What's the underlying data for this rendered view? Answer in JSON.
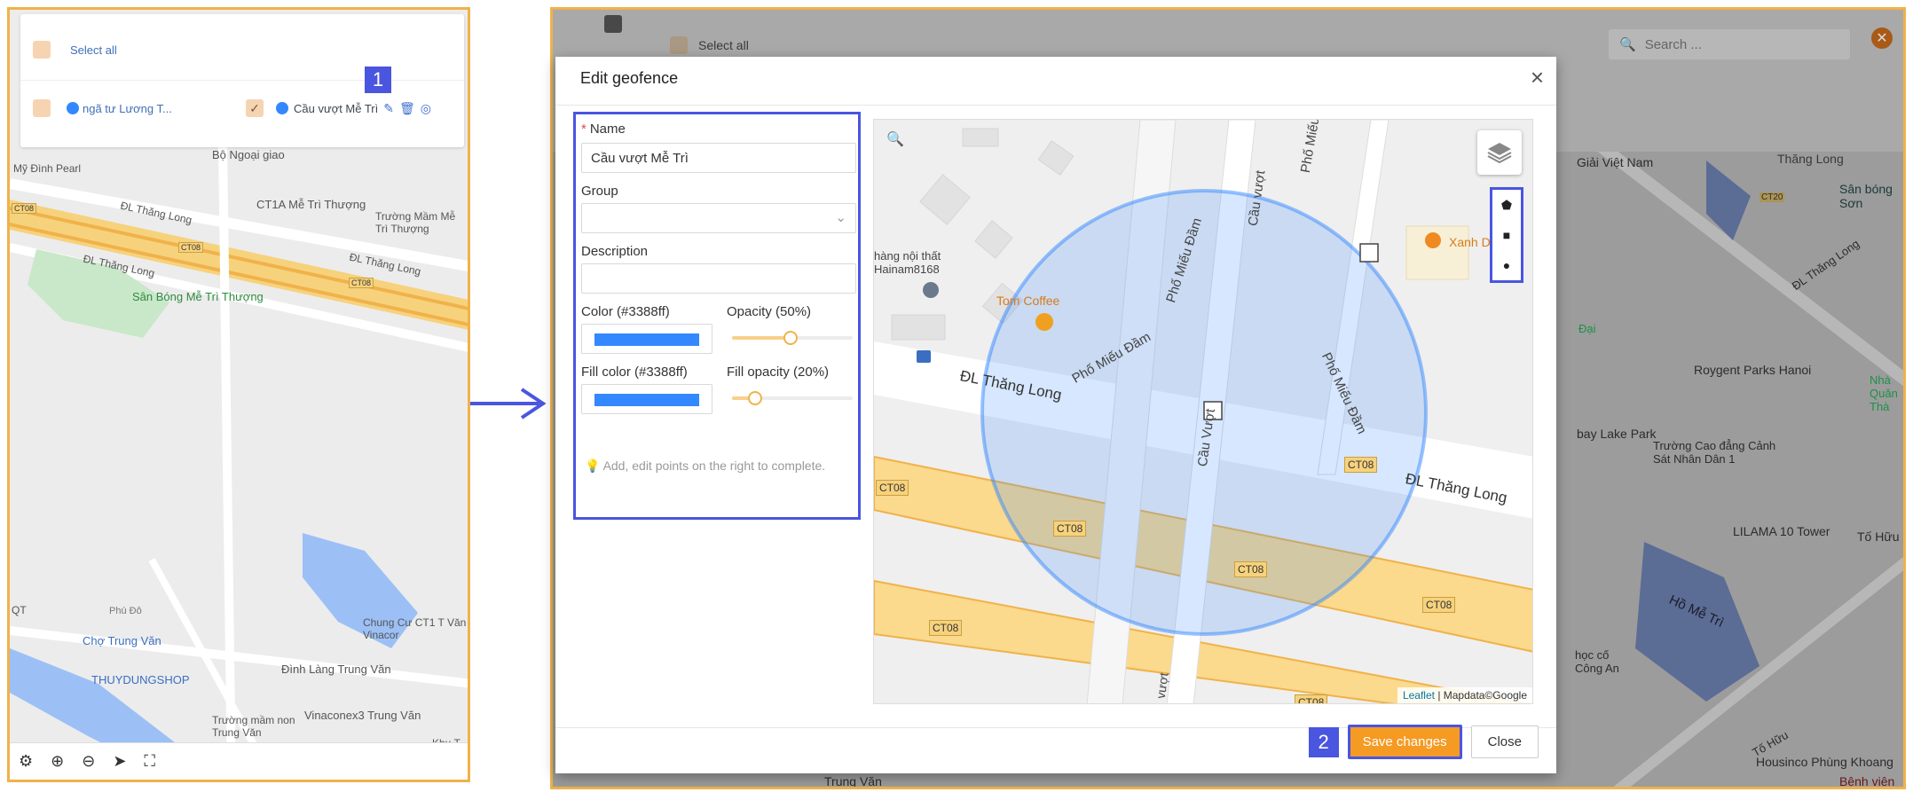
{
  "left_panel": {
    "select_all": "Select all",
    "items": [
      {
        "label": "ngã tư Lương T..."
      },
      {
        "label": "Cầu vượt Mễ Trì"
      }
    ],
    "badge": "1",
    "map_labels": {
      "my_dinh_pearl": "Mỹ Đình Pearl",
      "bo_ngoai_giao": "Bộ Ngoại giao",
      "dl_thang_long_1": "ĐL Thăng Long",
      "dl_thang_long_2": "ĐL Thăng Long",
      "dl_thang_long_3": "ĐL Thăng Long",
      "ct1a": "CT1A Mễ Trì Thượng",
      "truong_mam": "Trường Mầm Mễ Trì Thượng",
      "san_bong": "Sân Bóng Mễ Trì Thượng",
      "phu_do": "Phú Đô",
      "cho_trung_van": "Chợ Trung Văn",
      "thuydungshop": "THUYDUNGSHOP",
      "dinh_lang": "Đình Làng Trung Văn",
      "truong_mam_non": "Trường mầm non Trung Văn",
      "vinaconex3": "Vinaconex3 Trung Văn",
      "chung_cu": "Chung Cư CT1 T Văn Vinacor",
      "khu": "Khu T",
      "qt": "QT",
      "ct08_a": "CT08",
      "ct08_b": "CT08",
      "ct08_c": "CT08"
    }
  },
  "right_panel": {
    "select_all": "Select all",
    "search_placeholder": "Search ...",
    "close_icon": "✕",
    "bg_labels": {
      "giai_viet_nam": "Giải Việt Nam",
      "thang_long": "Thăng Long",
      "san_bong_son": "Sân bóng Sơn",
      "dl_thang_long": "ĐL Thăng Long",
      "royal_parks": "Roygent Parks Hanoi",
      "bay_lake_park": "bay Lake Park",
      "truong_cao_dang": "Trường Cao đẳng Cảnh Sát Nhân Dân 1",
      "lilama": "LILAMA 10 Tower",
      "ho_me_tri": "Hồ Mễ Trì",
      "to_huu_1": "Tố Hữu",
      "to_huu_2": "Tố Hữu",
      "housinco": "Housinco Phùng Khoang",
      "benh_vien": "Bệnh viện",
      "trung_van": "Trung Văn",
      "hoc_co": "học cố Công An",
      "nha": "Nhà Quân Thà",
      "ct20": "CT20",
      "dai": "Đại"
    },
    "badge": "2"
  },
  "modal": {
    "title": "Edit geofence",
    "name_label": "Name",
    "name_required_mark": "*",
    "name_value": "Cầu vượt Mễ Trì",
    "group_label": "Group",
    "description_label": "Description",
    "color_label": "Color (#3388ff)",
    "opacity_label": "Opacity (50%)",
    "fill_color_label": "Fill color (#3388ff)",
    "fill_opacity_label": "Fill opacity (20%)",
    "opacity_value": 0.5,
    "fill_opacity_value": 0.2,
    "hint": "Add, edit points on the right to complete.",
    "save_label": "Save changes",
    "close_label": "Close",
    "colors": {
      "stroke": "#3388ff",
      "fill": "#3388ff",
      "accent": "#f59a23",
      "highlight": "#4a55e0"
    },
    "map": {
      "attribution_link": "Leaflet",
      "attribution_text": "| Mapdata©Google",
      "labels": {
        "hang_noi_that": "hàng nội thất Hainam8168",
        "tom_coffee": "Tom Coffee",
        "xanh": "Xanh D",
        "pho_mieu_dam_1": "Phố Miếu Đầm",
        "pho_mieu_dam_2": "Phố Miếu Đầm",
        "pho_mieu_dam_3": "Phố Miếu Đầm",
        "pho_mieu_4": "Phố Miếu",
        "cau_vuot_1": "Cầu vượt",
        "cau_vuot_2": "Cầu Vượt",
        "vuot": "vượt",
        "dl_thang_long_1": "ĐL Thăng Long",
        "dl_thang_long_2": "ĐL Thăng Long",
        "ct08_1": "CT08",
        "ct08_2": "CT08",
        "ct08_3": "CT08",
        "ct08_4": "CT08",
        "ct08_5": "CT08",
        "ct08_6": "CT08",
        "ct08_7": "CT08"
      }
    }
  }
}
